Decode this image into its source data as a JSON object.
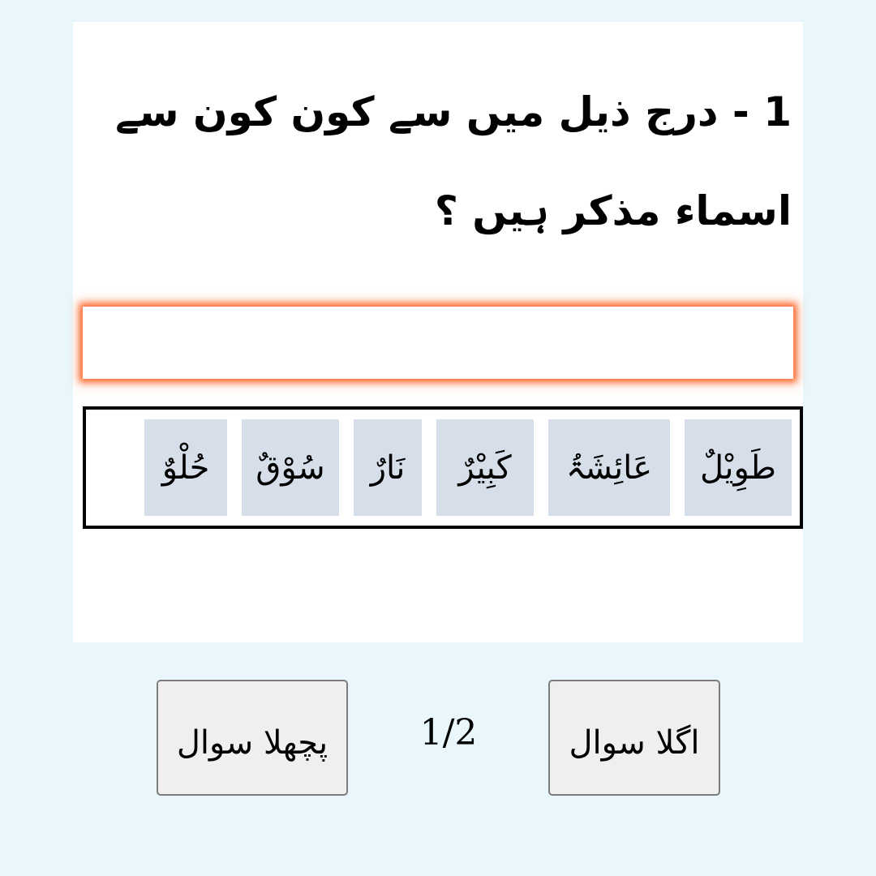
{
  "question": {
    "number": "1",
    "separator": "-",
    "text": "درج ذیل میں سے کون کون سے اسماء مذکر ہیں ؟"
  },
  "answer_box": {
    "value": ""
  },
  "options": [
    "طَوِیْلٌ",
    "عَائِشَۃُ",
    "کَبِیْرٌ",
    "نَارٌ",
    "سُوْقٌ",
    "حُلْوٌ"
  ],
  "navigation": {
    "prev_label": "پچھلا سوال",
    "next_label": "اگلا سوال",
    "page_indicator": "1/2"
  },
  "colors": {
    "page_background": "#e9f7fc",
    "card_background": "#ffffff",
    "option_chip": "#d6dfe9",
    "answer_glow": "#ff6a2e",
    "button_background": "#efefef",
    "button_border": "#7d7d7d"
  }
}
